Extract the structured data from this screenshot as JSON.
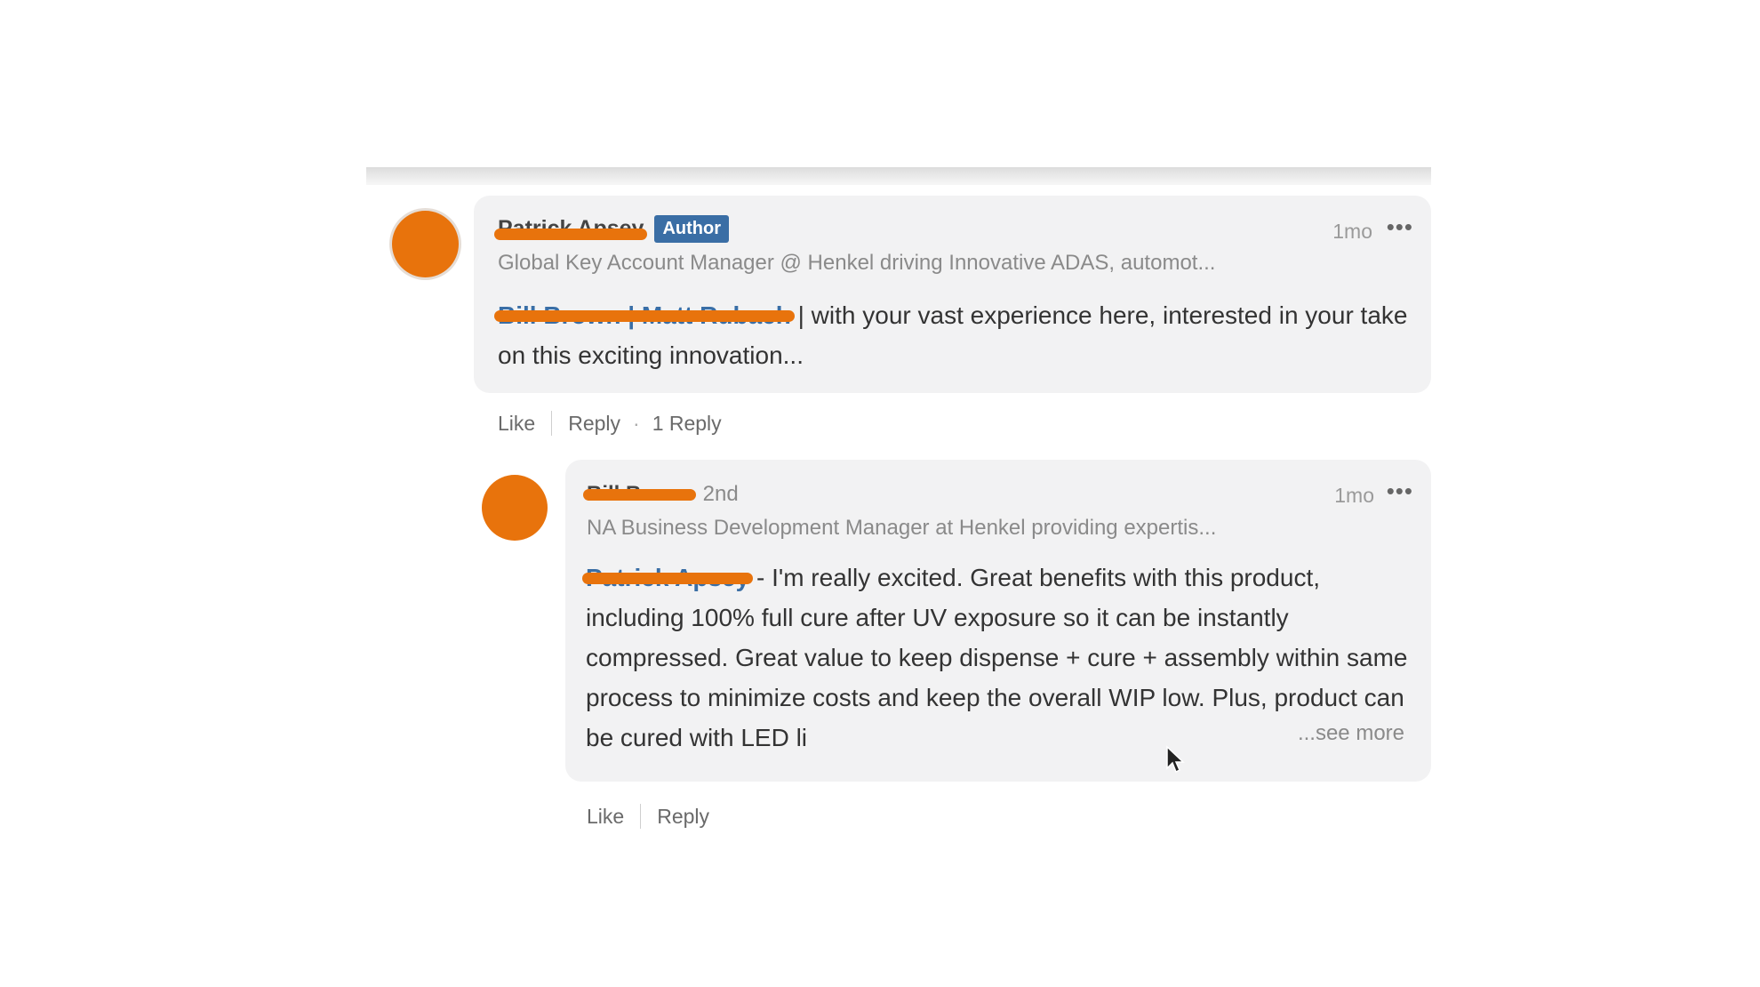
{
  "colors": {
    "redaction": "#e8730c",
    "author_badge": "#3a6ea5",
    "mention_link": "#3a6ea5",
    "bubble_bg": "#f2f2f3"
  },
  "comments": [
    {
      "author_name": "Patrick Apsey",
      "badge": "Author",
      "degree": "",
      "headline": "Global Key Account Manager @ Henkel driving Innovative ADAS, automot...",
      "time": "1mo",
      "more_icon": "ellipsis-icon",
      "mention": "Bill Brown | Matt Rubach",
      "body": " | with your vast experience here, interested in your take on this exciting innovation...",
      "see_more": "",
      "actions": {
        "like": "Like",
        "reply": "Reply",
        "reply_count": "1 Reply"
      }
    },
    {
      "author_name": "Bill Brown",
      "badge": "",
      "degree": "2nd",
      "headline": "NA Business Development Manager at Henkel providing expertis...",
      "time": "1mo",
      "more_icon": "ellipsis-icon",
      "mention": "Patrick Apsey",
      "body": " - I'm really excited.  Great benefits with this product, including 100% full cure after UV exposure so it can be instantly compressed.  Great value to keep dispense + cure + assembly within same process to minimize costs and keep the overall WIP low.  Plus, product can be cured with LED li",
      "see_more": "...see more",
      "actions": {
        "like": "Like",
        "reply": "Reply",
        "reply_count": ""
      }
    }
  ]
}
